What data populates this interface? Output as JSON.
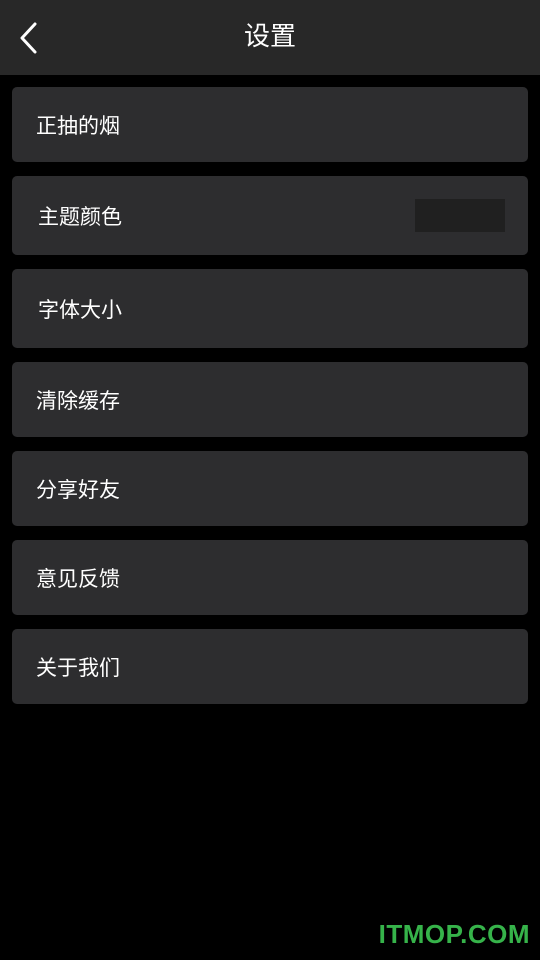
{
  "header": {
    "title": "设置"
  },
  "settings": {
    "items": [
      {
        "label": "正抽的烟"
      },
      {
        "label": "主题颜色",
        "swatch_color": "#202020"
      },
      {
        "label": "字体大小"
      },
      {
        "label": "清除缓存"
      },
      {
        "label": "分享好友"
      },
      {
        "label": "意见反馈"
      },
      {
        "label": "关于我们"
      }
    ]
  },
  "watermark": {
    "text": "ITMOP.COM"
  },
  "colors": {
    "background": "#000000",
    "header_bg": "#282828",
    "row_bg": "#2d2d2f",
    "text": "#ffffff",
    "watermark": "#36b34a"
  },
  "icons": {
    "back": "chevron-left-icon"
  }
}
